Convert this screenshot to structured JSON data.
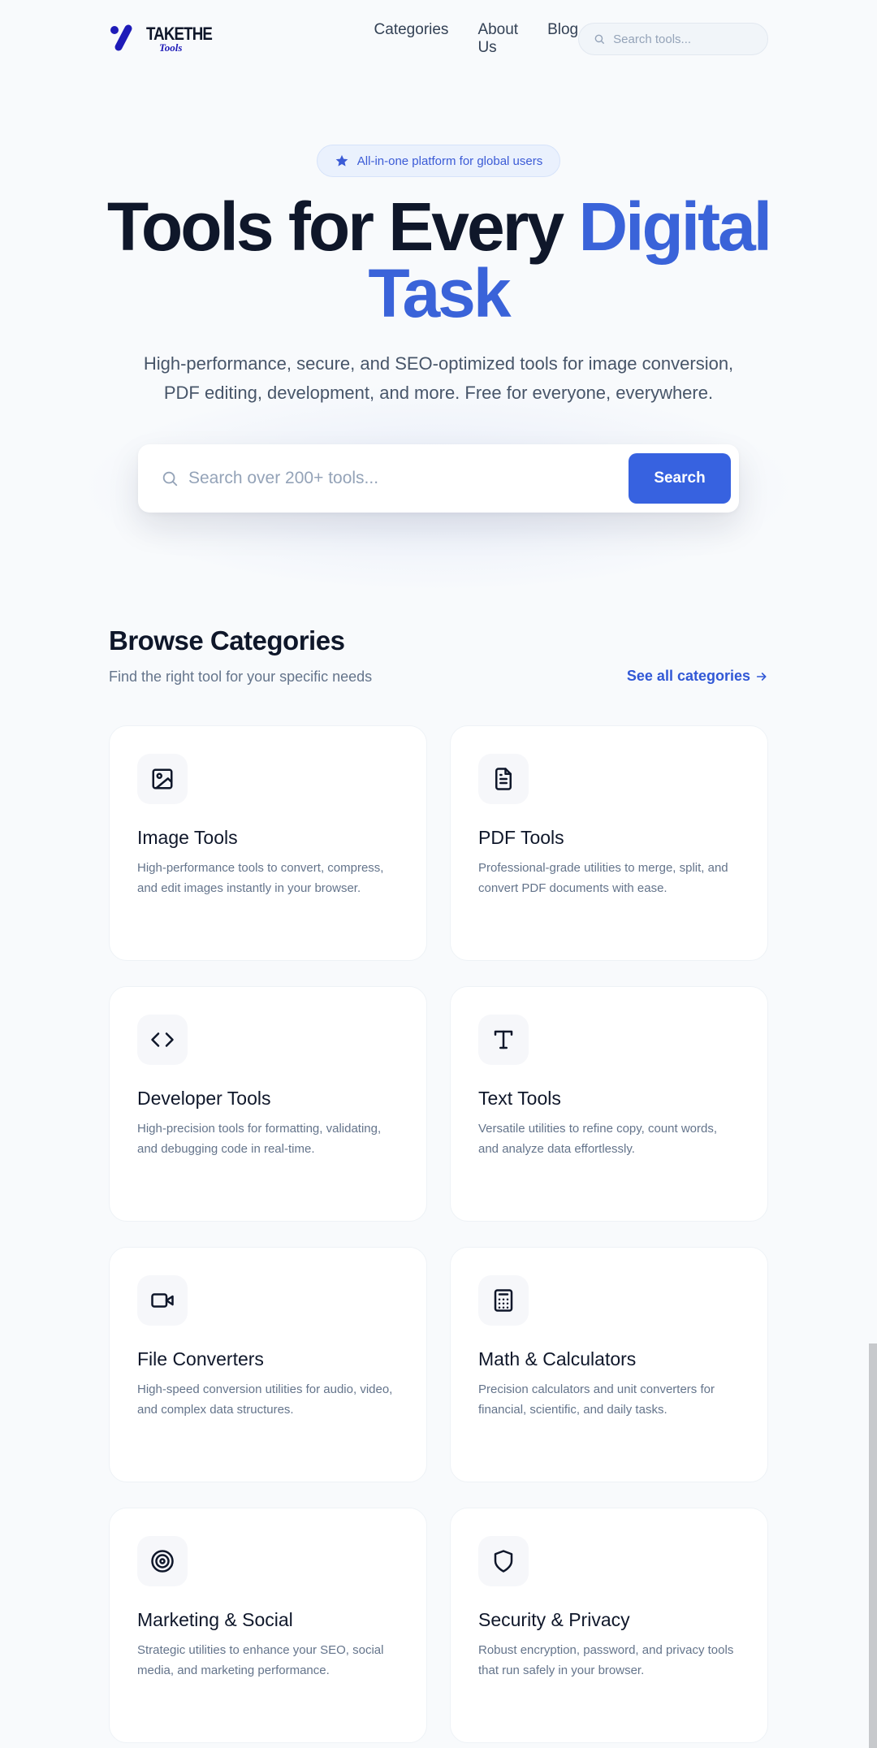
{
  "brand": {
    "top": "TAKETHE",
    "bottom": "Tools",
    "mark_color": "#1e1bb8"
  },
  "nav": {
    "items": [
      "Categories",
      "About Us",
      "Blog"
    ]
  },
  "header_search": {
    "placeholder": "Search tools...",
    "icon": "search-icon"
  },
  "hero": {
    "badge": "All-in-one platform for global users",
    "badge_icon": "star-icon",
    "title_part1": "Tools for Every ",
    "title_accent1": "Digital",
    "title_accent2": "Task",
    "subtitle": "High-performance, secure, and SEO-optimized tools for image conversion, PDF editing, development, and more. Free for everyone, everywhere.",
    "search_placeholder": "Search over 200+ tools...",
    "search_button": "Search",
    "accent_color": "#3a63d9"
  },
  "categories": {
    "title": "Browse Categories",
    "subtitle": "Find the right tool for your specific needs",
    "see_all": "See all categories",
    "items": [
      {
        "name": "Image Tools",
        "desc": "High-performance tools to convert, compress, and edit images instantly in your browser.",
        "icon": "image-icon"
      },
      {
        "name": "PDF Tools",
        "desc": "Professional-grade utilities to merge, split, and convert PDF documents with ease.",
        "icon": "file-text-icon"
      },
      {
        "name": "Developer Tools",
        "desc": "High-precision tools for formatting, validating, and debugging code in real-time.",
        "icon": "code-icon"
      },
      {
        "name": "Text Tools",
        "desc": "Versatile utilities to refine copy, count words, and analyze data effortlessly.",
        "icon": "type-icon"
      },
      {
        "name": "File Converters",
        "desc": "High-speed conversion utilities for audio, video, and complex data structures.",
        "icon": "video-icon"
      },
      {
        "name": "Math & Calculators",
        "desc": "Precision calculators and unit converters for financial, scientific, and daily tasks.",
        "icon": "calculator-icon"
      },
      {
        "name": "Marketing & Social",
        "desc": "Strategic utilities to enhance your SEO, social media, and marketing performance.",
        "icon": "target-icon"
      },
      {
        "name": "Security & Privacy",
        "desc": "Robust encryption, password, and privacy tools that run safely in your browser.",
        "icon": "shield-icon"
      }
    ]
  }
}
